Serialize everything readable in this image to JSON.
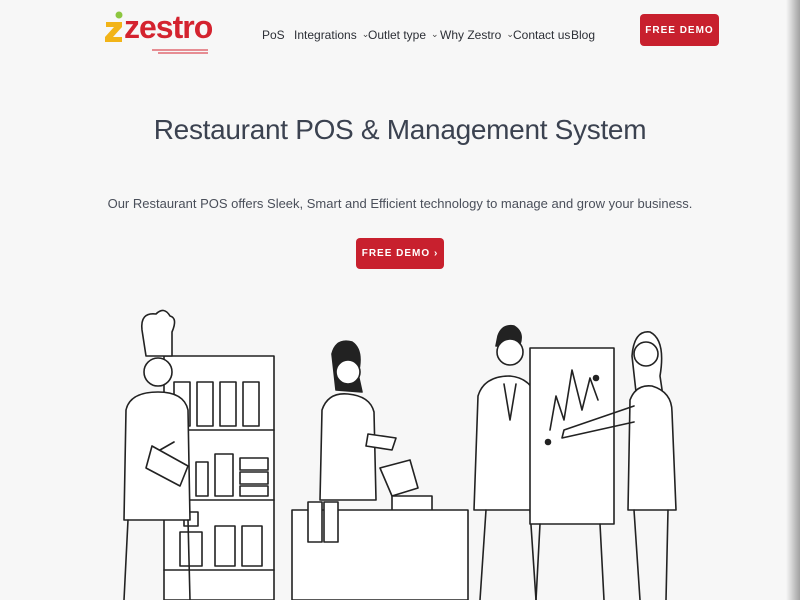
{
  "brand": {
    "name": "zestro"
  },
  "nav": {
    "items": [
      {
        "label": "PoS",
        "has_dropdown": false
      },
      {
        "label": "Integrations",
        "has_dropdown": true
      },
      {
        "label": "Outlet type",
        "has_dropdown": true
      },
      {
        "label": "Why Zestro",
        "has_dropdown": true
      },
      {
        "label": "Contact us",
        "has_dropdown": false
      },
      {
        "label": "Blog",
        "has_dropdown": false
      }
    ],
    "cta_label": "FREE DEMO"
  },
  "hero": {
    "title": "Restaurant POS & Management System",
    "subtitle": "Our Restaurant POS offers Sleek, Smart and Efficient technology to manage and grow your business.",
    "cta_label": "FREE DEMO ›"
  },
  "colors": {
    "accent": "#c8202e",
    "text": "#3b4250",
    "background": "#f7f7f7"
  },
  "icons": {
    "dropdown": "chevron-down-icon"
  }
}
